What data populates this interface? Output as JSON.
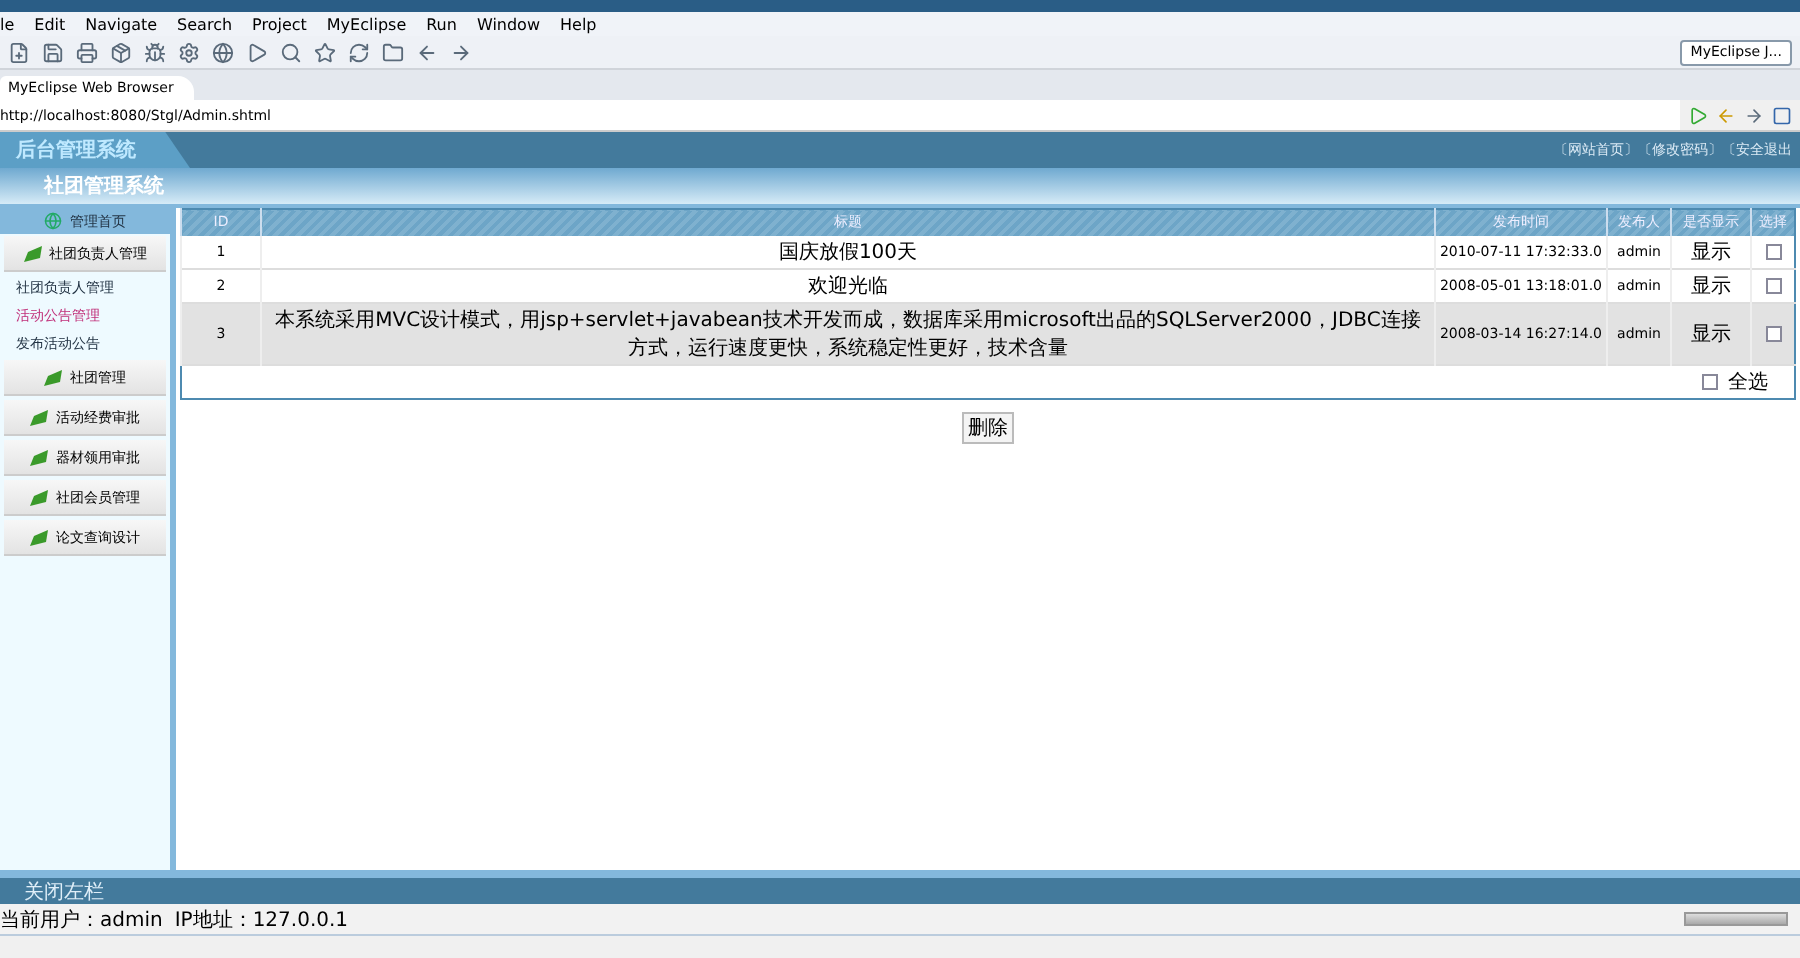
{
  "menu": [
    "le",
    "Edit",
    "Navigate",
    "Search",
    "Project",
    "MyEclipse",
    "Run",
    "Window",
    "Help"
  ],
  "perspective": "MyEclipse J...",
  "editor_tab": {
    "label": "MyEclipse Web Browser",
    "selected": true
  },
  "address": "http://localhost:8080/Stgl/Admin.shtml",
  "header": {
    "title": "后台管理系统",
    "subtitle": "社团管理系统",
    "links": [
      "〔网站首页〕",
      "〔修改密码〕",
      "〔安全退出"
    ]
  },
  "sidebar": {
    "title": "管理首页",
    "items": [
      {
        "kind": "button",
        "label": "社团负责人管理",
        "selected": false
      },
      {
        "kind": "link",
        "label": "社团负责人管理",
        "selected": false
      },
      {
        "kind": "link",
        "label": "活动公告管理",
        "selected": true
      },
      {
        "kind": "link",
        "label": "发布活动公告",
        "selected": false
      },
      {
        "kind": "button",
        "label": "社团管理",
        "selected": false
      },
      {
        "kind": "button",
        "label": "活动经费审批",
        "selected": false
      },
      {
        "kind": "button",
        "label": "器材领用审批",
        "selected": false
      },
      {
        "kind": "button",
        "label": "社团会员管理",
        "selected": false
      },
      {
        "kind": "button",
        "label": "论文查询设计",
        "selected": false
      }
    ]
  },
  "table": {
    "columns": [
      "ID",
      "标题",
      "发布时间",
      "发布人",
      "是否显示",
      "选择"
    ],
    "rows": [
      {
        "id": "1",
        "title": "国庆放假100天",
        "time": "2010-07-11 17:32:33.0",
        "author": "admin",
        "shown": "显示",
        "selected": false,
        "checked": false
      },
      {
        "id": "2",
        "title": "欢迎光临",
        "time": "2008-05-01 13:18:01.0",
        "author": "admin",
        "shown": "显示",
        "selected": false,
        "checked": false
      },
      {
        "id": "3",
        "title": "本系统采用MVC设计模式，用jsp+servlet+javabean技术开发而成，数据库采用microsoft出品的SQLServer2000，JDBC连接方式，运行速度更快，系统稳定性更好，技术含量",
        "time": "2008-03-14 16:27:14.0",
        "author": "admin",
        "shown": "显示",
        "selected": true,
        "checked": false
      }
    ],
    "select_all": {
      "label": "全选",
      "checked": false
    }
  },
  "delete_button": "删除",
  "close_sidebar": "关闭左栏",
  "status": [
    "当前用户：admin",
    "IP地址：127.0.0.1"
  ]
}
